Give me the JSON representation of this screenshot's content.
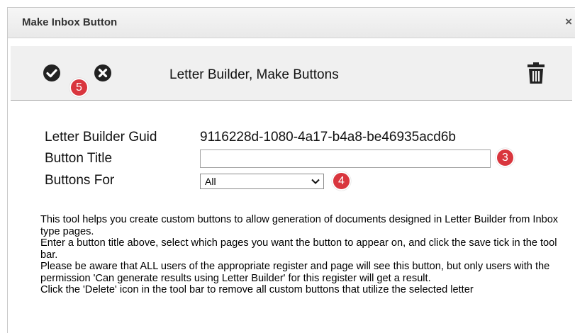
{
  "dialog": {
    "title": "Make Inbox Button",
    "close_glyph": "×"
  },
  "toolbar": {
    "title": "Letter Builder, Make Buttons",
    "save_icon": "check-circle-icon",
    "cancel_icon": "x-circle-icon",
    "delete_icon": "trash-icon"
  },
  "annotations": {
    "step_save": "5",
    "step_title": "3",
    "step_buttons_for": "4",
    "badge_color": "#d9363e"
  },
  "form": {
    "guid_label": "Letter Builder Guid",
    "guid_value": "9116228d-1080-4a17-b4a8-be46935acd6b",
    "button_title_label": "Button Title",
    "button_title_value": "",
    "buttons_for_label": "Buttons For",
    "buttons_for_value": "All"
  },
  "help_text": [
    "This tool helps you create custom buttons to allow generation of documents designed in Letter Builder from Inbox type pages.",
    "Enter a button title above, select which pages you want the button to appear on, and click the save tick in the tool bar.",
    "Please be aware that ALL users of the appropriate register and page will see this button, but only users with the permission 'Can generate results using Letter Builder' for this register will get a result.",
    "Click the 'Delete' icon in the tool bar to remove all custom buttons that utilize the selected letter"
  ]
}
